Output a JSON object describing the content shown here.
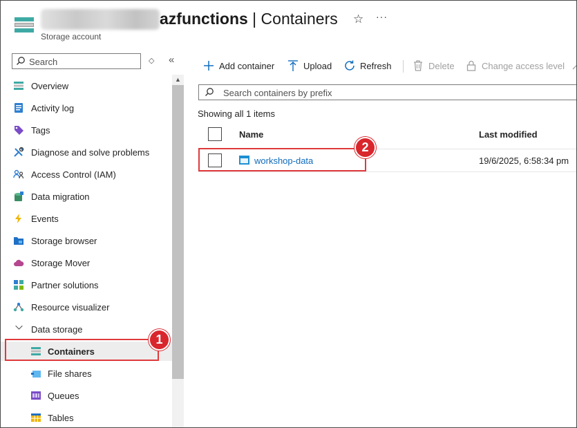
{
  "header": {
    "title_bold": "azfunctions",
    "title_rest": " | Containers",
    "subtitle": "Storage account",
    "favorite_icon": "star-icon",
    "more_icon": "ellipsis-icon"
  },
  "sidebar": {
    "search_placeholder": "Search",
    "items": [
      {
        "label": "Overview",
        "icon": "overview-icon"
      },
      {
        "label": "Activity log",
        "icon": "activity-log-icon"
      },
      {
        "label": "Tags",
        "icon": "tag-icon"
      },
      {
        "label": "Diagnose and solve problems",
        "icon": "wrench-icon"
      },
      {
        "label": "Access Control (IAM)",
        "icon": "people-icon"
      },
      {
        "label": "Data migration",
        "icon": "data-migration-icon"
      },
      {
        "label": "Events",
        "icon": "lightning-icon"
      },
      {
        "label": "Storage browser",
        "icon": "folder-icon"
      },
      {
        "label": "Storage Mover",
        "icon": "cloud-icon"
      },
      {
        "label": "Partner solutions",
        "icon": "partner-icon"
      },
      {
        "label": "Resource visualizer",
        "icon": "visualizer-icon"
      },
      {
        "label": "Data storage",
        "icon": "chevron-down-icon"
      },
      {
        "label": "Containers",
        "icon": "containers-icon"
      },
      {
        "label": "File shares",
        "icon": "file-share-icon"
      },
      {
        "label": "Queues",
        "icon": "queue-icon"
      },
      {
        "label": "Tables",
        "icon": "table-icon"
      }
    ]
  },
  "toolbar": {
    "add_container": "Add container",
    "upload": "Upload",
    "refresh": "Refresh",
    "delete": "Delete",
    "change_access": "Change access level"
  },
  "content": {
    "filter_placeholder": "Search containers by prefix",
    "count_text": "Showing all 1 items",
    "columns": {
      "name": "Name",
      "modified": "Last modified"
    },
    "rows": [
      {
        "name": "workshop-data",
        "modified": "19/6/2025, 6:58:34 pm"
      }
    ]
  },
  "callouts": {
    "one": "1",
    "two": "2"
  },
  "colors": {
    "accent": "#0f6cbd",
    "callout": "#d9262c",
    "teal": "#3fa9a4"
  }
}
